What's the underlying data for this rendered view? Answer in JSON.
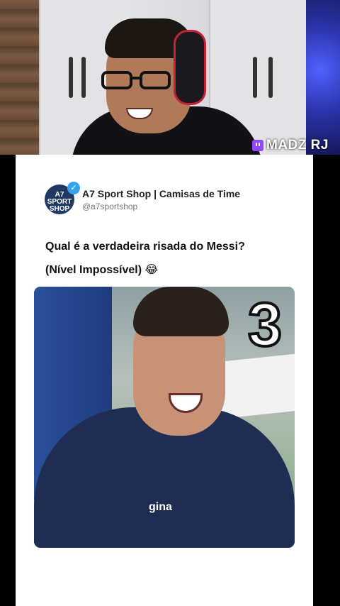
{
  "overlay": {
    "channel_name": "MADZ RJ",
    "platform_icon": "twitch-icon"
  },
  "post": {
    "account_name": "A7 Sport Shop | Camisas de Time",
    "handle": "@a7sportshop",
    "avatar_text": "A7 SPORT SHOP",
    "verified_icon": "verified-check-icon",
    "question": "Qual é a verdadeira risada do Messi?",
    "subtitle": "(Nível Impossível) 😂"
  },
  "video": {
    "number": "3",
    "sponsor_text": "gina"
  },
  "colors": {
    "twitch": "#9146ff",
    "verified": "#36a3f0",
    "card_bg": "#ffffff"
  }
}
